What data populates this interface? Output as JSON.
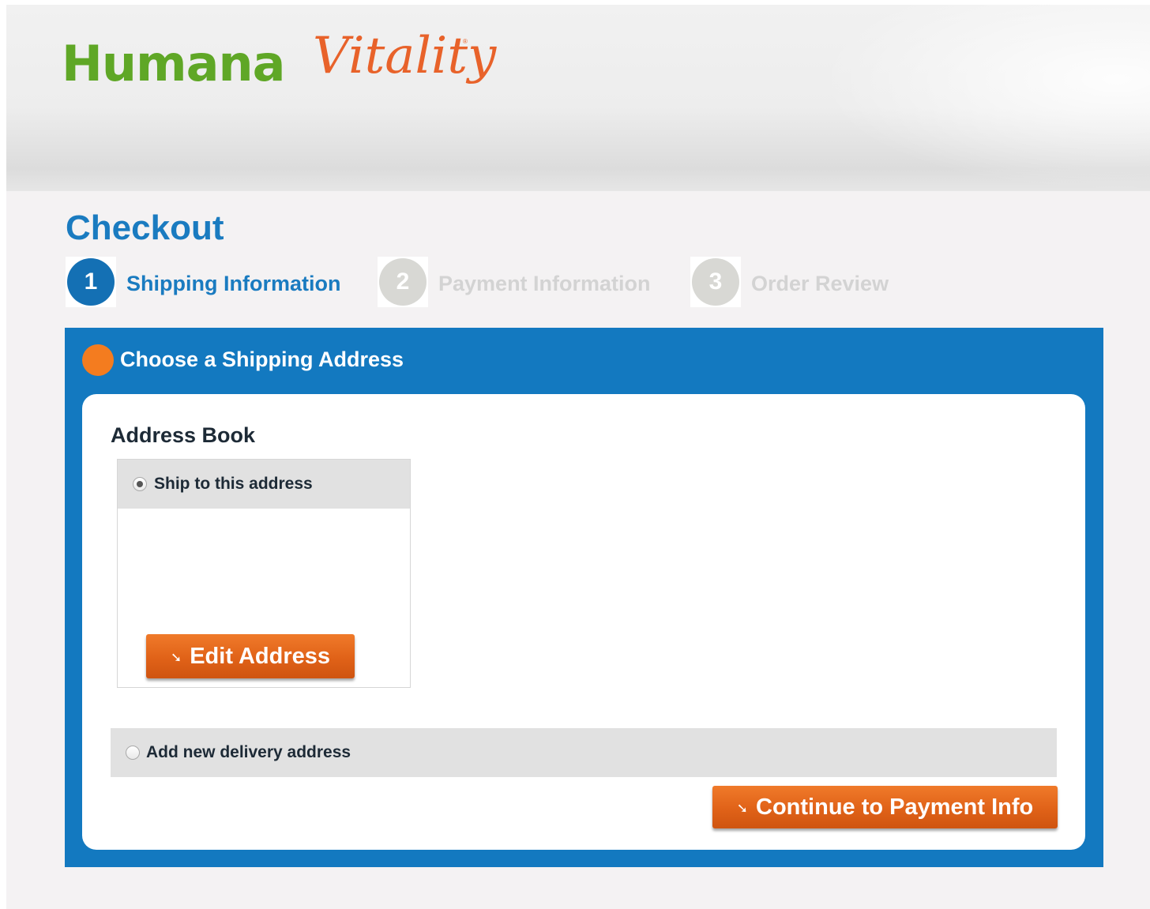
{
  "header": {
    "logo_humana": "Humana",
    "logo_vitality": "Vitality",
    "logo_tm": "®"
  },
  "page_title": "Checkout",
  "steps": [
    {
      "number": "1",
      "label": "Shipping Information",
      "state": "active"
    },
    {
      "number": "2",
      "label": "Payment Information",
      "state": "inactive"
    },
    {
      "number": "3",
      "label": "Order Review",
      "state": "inactive"
    }
  ],
  "panel": {
    "title": "Choose a Shipping Address",
    "address_book_title": "Address Book",
    "ship_to_label": "Ship to this address",
    "ship_to_selected": true,
    "edit_button_label": "Edit Address",
    "add_new_label": "Add new delivery address",
    "add_new_selected": false,
    "continue_button_label": "Continue to Payment Info",
    "button_arrow_icon": "arrow-down-right-icon"
  },
  "colors": {
    "brand_green": "#5fa726",
    "brand_orange": "#e8622a",
    "primary_blue": "#1379c0",
    "title_blue": "#1a7bc0",
    "button_orange": "#e06218",
    "step_inactive": "#d8d8d4"
  }
}
